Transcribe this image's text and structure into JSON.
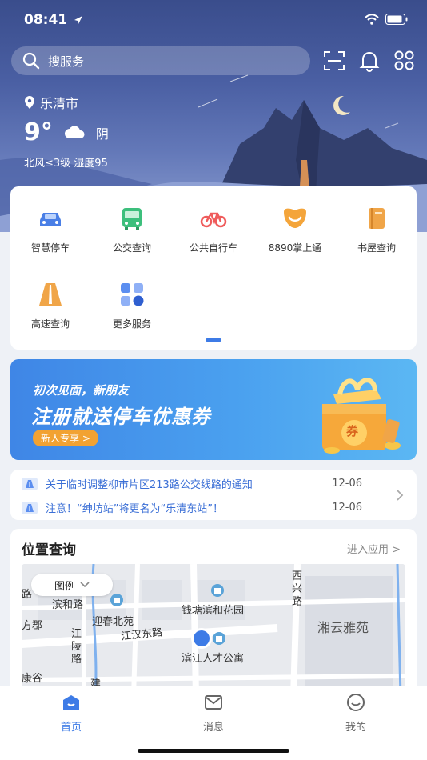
{
  "status": {
    "time": "08:41"
  },
  "search": {
    "placeholder": "搜服务"
  },
  "weather": {
    "city": "乐清市",
    "temp": "9°",
    "condition": "阴",
    "detail": "北风≤3级 湿度95"
  },
  "services": [
    {
      "label": "智慧停车",
      "icon": "car-icon"
    },
    {
      "label": "公交查询",
      "icon": "bus-icon"
    },
    {
      "label": "公共自行车",
      "icon": "bicycle-icon"
    },
    {
      "label": "8890掌上通",
      "icon": "smile-icon"
    },
    {
      "label": "书屋查询",
      "icon": "book-icon"
    },
    {
      "label": "高速查询",
      "icon": "highway-icon"
    },
    {
      "label": "更多服务",
      "icon": "grid-icon"
    }
  ],
  "banner": {
    "line1": "初次见面，新朋友",
    "line2": "注册就送停车优惠券",
    "cta": "新人专享 >",
    "coupon": "券"
  },
  "notices": [
    {
      "text": "关于临时调整柳市片区213路公交线路的通知",
      "date": "12-06"
    },
    {
      "text": "注意！“绅坊站”将更名为“乐清东站”！",
      "date": "12-06"
    }
  ],
  "location": {
    "title": "位置查询",
    "enter": "进入应用 >",
    "legend": "图例",
    "map_labels": {
      "road1": "滨和路",
      "road2": "迎春北苑",
      "road3": "钱塘滨和花园",
      "road4": "江汉东路",
      "road5": "江陵路",
      "road6": "滨江人才公寓",
      "road7": "湘云雅苑",
      "road8": "西兴路",
      "road9": "路",
      "road10": "方郡",
      "road11": "康谷",
      "road12": "建"
    }
  },
  "tabs": [
    {
      "label": "首页",
      "active": true
    },
    {
      "label": "消息",
      "active": false
    },
    {
      "label": "我的",
      "active": false
    }
  ],
  "colors": {
    "accent": "#3d7be6",
    "notice": "#3b6fd6"
  }
}
